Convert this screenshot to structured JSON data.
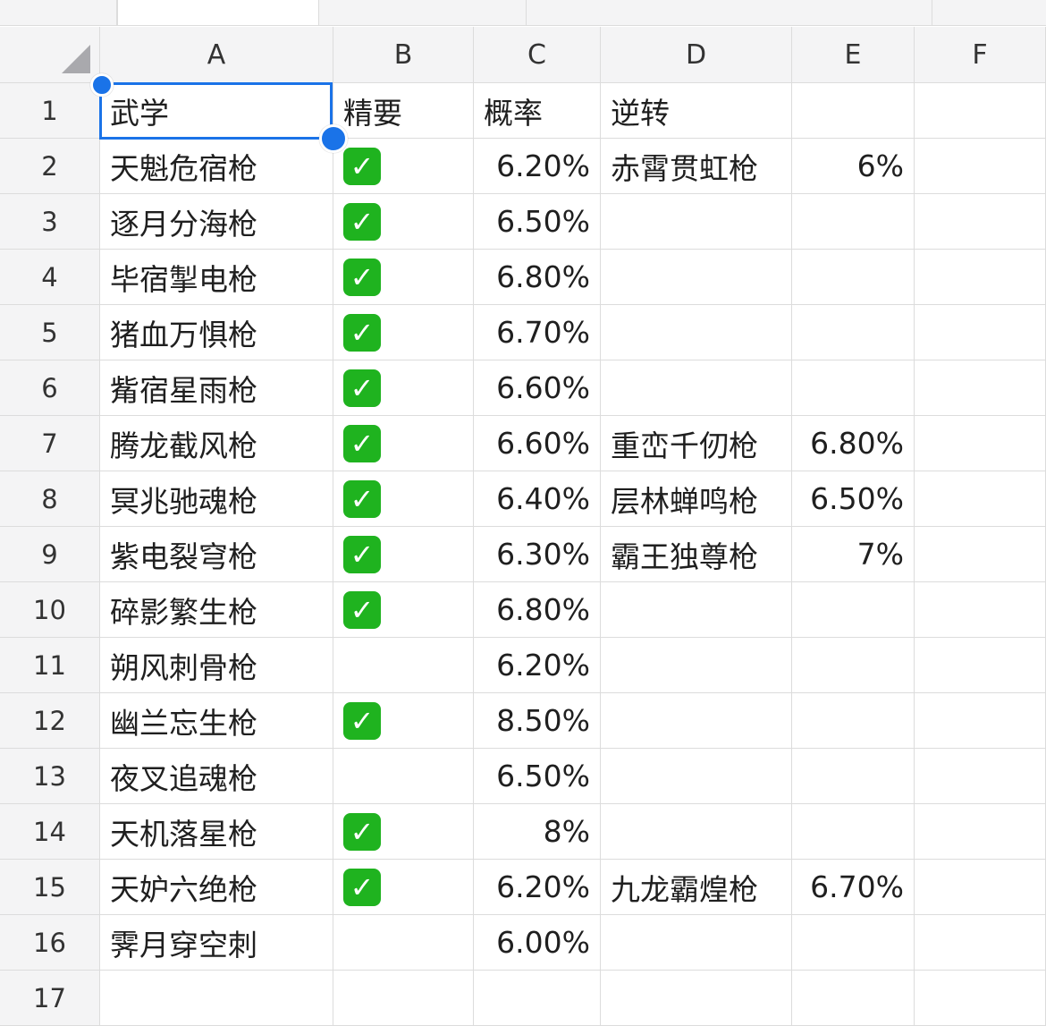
{
  "columns": [
    "A",
    "B",
    "C",
    "D",
    "E",
    "F"
  ],
  "rows": [
    {
      "num": "1",
      "a": "武学",
      "b": "精要",
      "c": "概率",
      "d": "逆转",
      "e": ""
    },
    {
      "num": "2",
      "a": "天魁危宿枪",
      "b": "✓",
      "c": "6.20%",
      "d": "赤霄贯虹枪",
      "e": "6%"
    },
    {
      "num": "3",
      "a": "逐月分海枪",
      "b": "✓",
      "c": "6.50%",
      "d": "",
      "e": ""
    },
    {
      "num": "4",
      "a": "毕宿掣电枪",
      "b": "✓",
      "c": "6.80%",
      "d": "",
      "e": ""
    },
    {
      "num": "5",
      "a": "猪血万惧枪",
      "b": "✓",
      "c": "6.70%",
      "d": "",
      "e": ""
    },
    {
      "num": "6",
      "a": "觜宿星雨枪",
      "b": "✓",
      "c": "6.60%",
      "d": "",
      "e": ""
    },
    {
      "num": "7",
      "a": "腾龙截风枪",
      "b": "✓",
      "c": "6.60%",
      "d": "重峦千仞枪",
      "e": "6.80%"
    },
    {
      "num": "8",
      "a": "冥兆驰魂枪",
      "b": "✓",
      "c": "6.40%",
      "d": "层林蝉鸣枪",
      "e": "6.50%"
    },
    {
      "num": "9",
      "a": "紫电裂穹枪",
      "b": "✓",
      "c": "6.30%",
      "d": "霸王独尊枪",
      "e": "7%"
    },
    {
      "num": "10",
      "a": "碎影繁生枪",
      "b": "✓",
      "c": "6.80%",
      "d": "",
      "e": ""
    },
    {
      "num": "11",
      "a": "朔风刺骨枪",
      "b": "",
      "c": "6.20%",
      "d": "",
      "e": ""
    },
    {
      "num": "12",
      "a": "幽兰忘生枪",
      "b": "✓",
      "c": "8.50%",
      "d": "",
      "e": ""
    },
    {
      "num": "13",
      "a": "夜叉追魂枪",
      "b": "",
      "c": "6.50%",
      "d": "",
      "e": ""
    },
    {
      "num": "14",
      "a": "天机落星枪",
      "b": "✓",
      "c": "8%",
      "d": "",
      "e": ""
    },
    {
      "num": "15",
      "a": "天妒六绝枪",
      "b": "✓",
      "c": "6.20%",
      "d": "九龙霸煌枪",
      "e": "6.70%"
    },
    {
      "num": "16",
      "a": "霁月穿空刺",
      "b": "",
      "c": "6.00%",
      "d": "",
      "e": ""
    },
    {
      "num": "17",
      "a": "",
      "b": "",
      "c": "",
      "d": "",
      "e": ""
    }
  ],
  "icons": {
    "checkbox": "check-mark-button-icon"
  },
  "colors": {
    "accent": "#1a73e8",
    "check": "#1fb31f"
  }
}
